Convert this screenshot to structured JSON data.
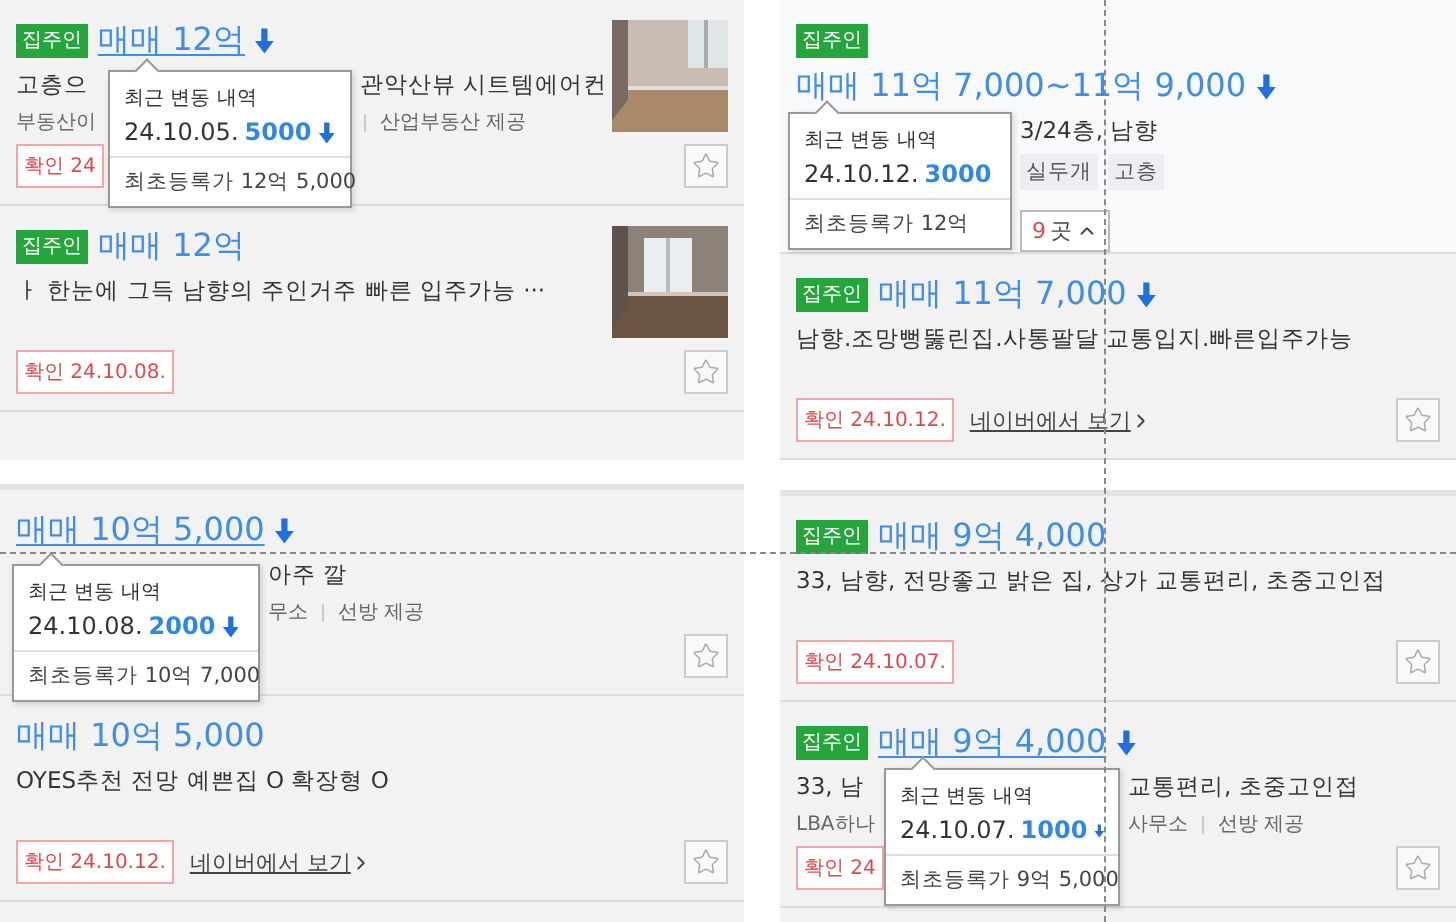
{
  "panels": [
    {
      "listings": [
        {
          "kind": "item",
          "badge": "집주인",
          "price": "매매 12억",
          "hovered": true,
          "drop": true,
          "desc": [
            "고층으",
            "관악산뷰 시트템에어컨"
          ],
          "agent": [
            "부동산이"
          ],
          "provider": "산업부동산 제공",
          "confirm": "확인 24",
          "thumbnail": {
            "kind": "picture"
          },
          "starred": false,
          "tooltip": {
            "title": "최근 변동 내역",
            "date": "24.10.05.",
            "change": "5000",
            "first": "최초등록가 12억 5,000"
          }
        },
        {
          "kind": "item",
          "badge": "집주인",
          "price": "매매 12억",
          "hovered": false,
          "drop": false,
          "desc": [
            "ㅏ 한눈에 그득 남향의 주인거주 빠른 입주가능 ···"
          ],
          "confirm": "확인 24.10.08.",
          "thumbnail": {
            "kind": "picture"
          },
          "starred": false
        }
      ]
    },
    {
      "listings": [
        {
          "kind": "complex",
          "badge": "집주인",
          "price": "매매 11억 7,000~11억 9,000",
          "hovered": false,
          "drop": true,
          "desc": [
            "3/24층, 남향"
          ],
          "tags": [
            "실두개",
            "고층"
          ],
          "agents_button": {
            "count": "9",
            "suffix": "곳",
            "expanded": true
          },
          "tooltip": {
            "title": "최근 변동 내역",
            "date": "24.10.12.",
            "change": "3000",
            "first": "최초등록가 12억"
          }
        },
        {
          "kind": "item",
          "badge": "집주인",
          "price": "매매 11억 7,000",
          "hovered": false,
          "drop": true,
          "desc": [
            "남향.조망뻥뚫린집.사통팔달 교통입지.빠른입주가능"
          ],
          "confirm": "확인 24.10.12.",
          "link": "네이버에서 보기",
          "starred": false
        }
      ]
    },
    {
      "listings": [
        {
          "kind": "item",
          "price": "매매 10억 5,000",
          "hovered": true,
          "drop": true,
          "desc": [
            "아주 깔"
          ],
          "agent": [
            "무소"
          ],
          "provider": "선방 제공",
          "starred": false,
          "tooltip": {
            "title": "최근 변동 내역",
            "date": "24.10.08.",
            "change": "2000",
            "first": "최초등록가 10억 7,000"
          }
        },
        {
          "kind": "item",
          "price": "매매 10억 5,000",
          "hovered": false,
          "drop": false,
          "desc": [
            "OYES추천 전망 예쁜집 O 확장형 O"
          ],
          "confirm": "확인 24.10.12.",
          "link": "네이버에서 보기",
          "starred": false
        }
      ]
    },
    {
      "listings": [
        {
          "kind": "item",
          "badge": "집주인",
          "price": "매매 9억 4,000",
          "hovered": false,
          "drop": false,
          "desc": [
            "33, 남향, 전망좋고 밝은 집, 상가 교통편리, 초중고인접"
          ],
          "confirm": "확인 24.10.07.",
          "starred": false
        },
        {
          "kind": "item",
          "badge": "집주인",
          "price": "매매 9억 4,000",
          "hovered": true,
          "drop": true,
          "desc": [
            "33, 남",
            "교통편리, 초중고인접"
          ],
          "agent": [
            "LBA하나",
            "사무소"
          ],
          "provider": "선방 제공",
          "confirm": "확인 24",
          "starred": false,
          "tooltip": {
            "title": "최근 변동 내역",
            "date": "24.10.07.",
            "change": "1000",
            "first": "최초등록가 9억 5,000"
          }
        }
      ]
    }
  ]
}
